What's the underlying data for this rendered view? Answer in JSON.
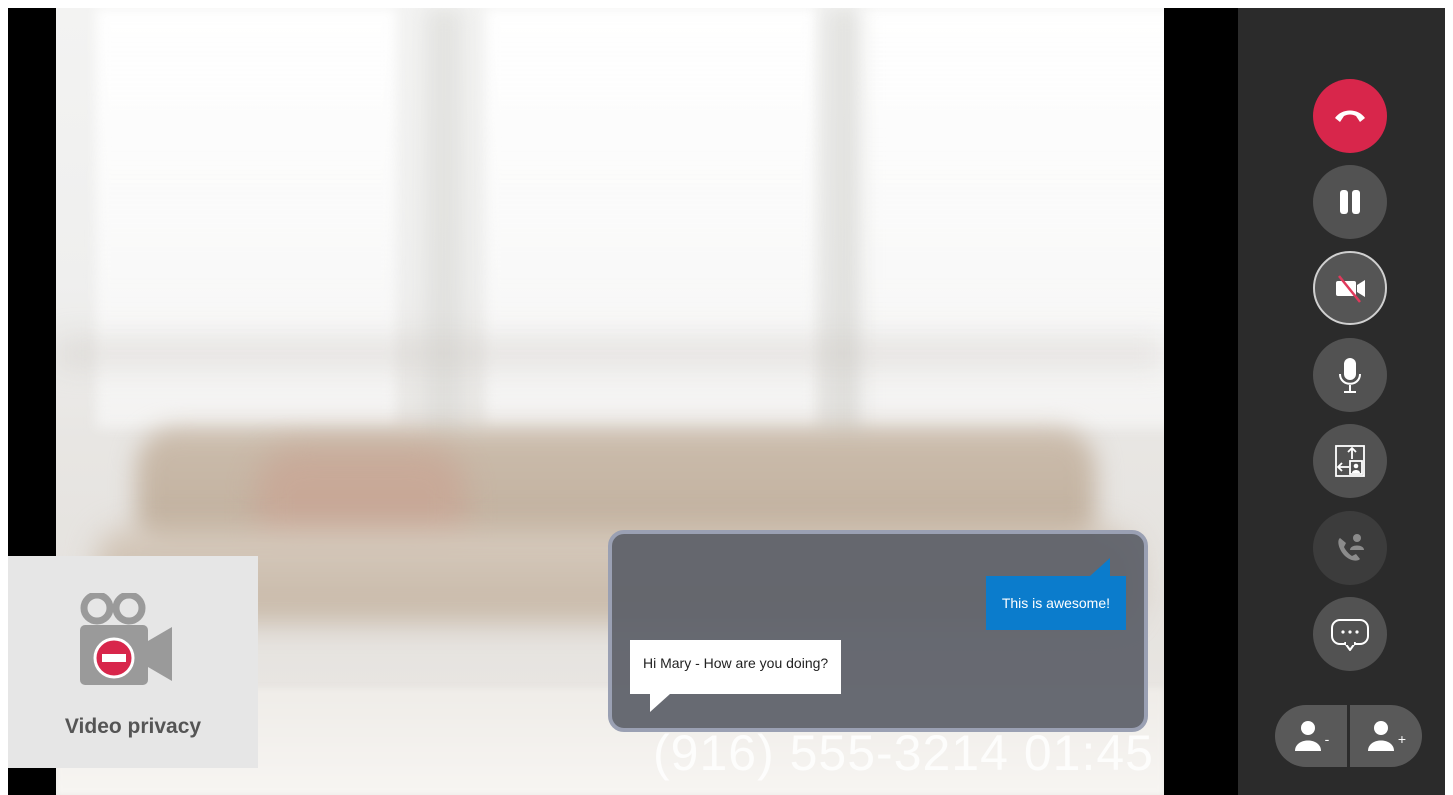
{
  "privacy_tile": {
    "label": "Video privacy"
  },
  "chat": {
    "messages": [
      {
        "from": "remote",
        "text": "This is awesome!"
      },
      {
        "from": "local",
        "text": "Hi Mary - How are you doing?"
      }
    ]
  },
  "call": {
    "number": "(916) 555-3214",
    "duration": "01:45"
  },
  "controls": {
    "buttons": [
      {
        "icon": "end-call-icon",
        "state": "default",
        "color": "#d8264b"
      },
      {
        "icon": "pause-icon",
        "state": "default"
      },
      {
        "icon": "video-off-icon",
        "state": "active"
      },
      {
        "icon": "microphone-icon",
        "state": "default"
      },
      {
        "icon": "switch-camera-icon",
        "state": "default"
      },
      {
        "icon": "add-call-icon",
        "state": "disabled"
      },
      {
        "icon": "chat-icon",
        "state": "default"
      }
    ],
    "volume": {
      "down_mark": "-",
      "up_mark": "+"
    }
  }
}
